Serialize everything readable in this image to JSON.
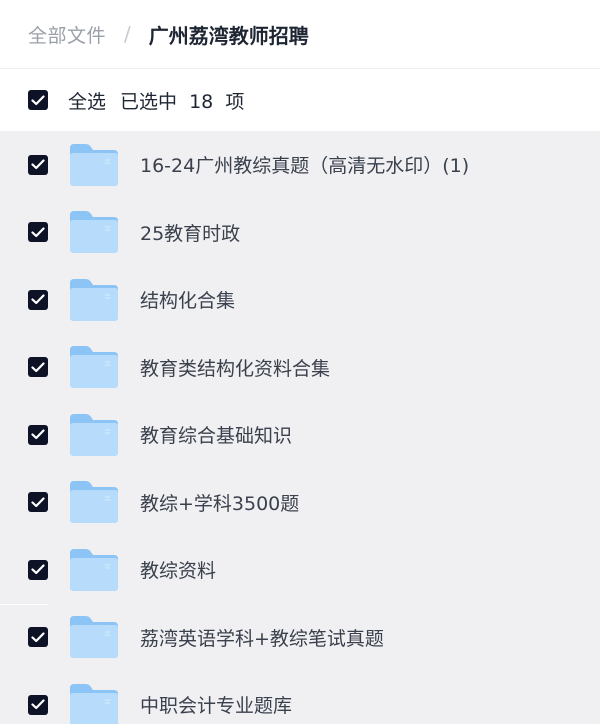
{
  "breadcrumb": {
    "root": "全部文件",
    "separator": "/",
    "current": "广州荔湾教师招聘"
  },
  "selection": {
    "select_all_label": "全选",
    "selected_text": "已选中  18  项"
  },
  "colors": {
    "checkbox": "#0e1226",
    "folder_back": "#8cc4f5",
    "folder_front": "#b7dcfb",
    "list_bg": "#f0f0f3"
  },
  "files": [
    {
      "name": "16-24广州教综真题（高清无水印）(1)",
      "icon": "folder-icon",
      "checked": true
    },
    {
      "name": "25教育时政",
      "icon": "folder-icon",
      "checked": true
    },
    {
      "name": "结构化合集",
      "icon": "folder-icon",
      "checked": true
    },
    {
      "name": "教育类结构化资料合集",
      "icon": "folder-icon",
      "checked": true
    },
    {
      "name": "教育综合基础知识",
      "icon": "folder-icon",
      "checked": true
    },
    {
      "name": "教综+学科3500题",
      "icon": "folder-icon",
      "checked": true
    },
    {
      "name": "教综资料",
      "icon": "folder-icon",
      "checked": true
    },
    {
      "name": "荔湾英语学科+教综笔试真题",
      "icon": "folder-icon",
      "checked": true
    },
    {
      "name": "中职会计专业题库",
      "icon": "folder-icon",
      "checked": true
    }
  ]
}
